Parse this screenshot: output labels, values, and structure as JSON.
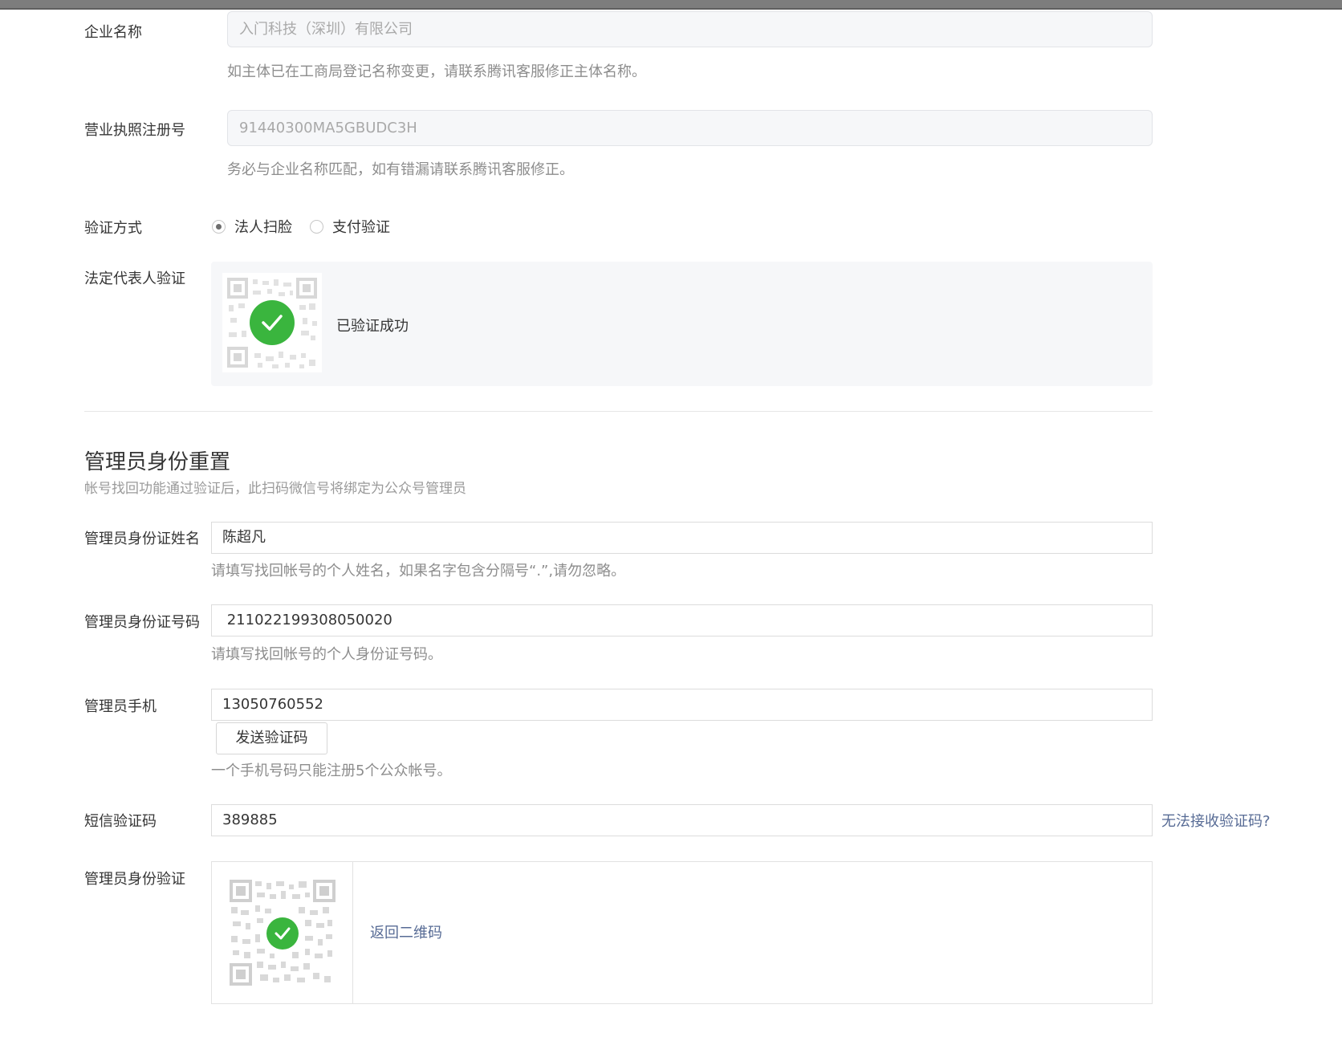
{
  "company": {
    "name_label": "企业名称",
    "name_value": "入门科技（深圳）有限公司",
    "name_hint": "如主体已在工商局登记名称变更，请联系腾讯客服修正主体名称。",
    "license_label": "营业执照注册号",
    "license_value": "91440300MA5GBUDC3H",
    "license_hint": "务必与企业名称匹配，如有错漏请联系腾讯客服修正。"
  },
  "verify_method": {
    "label": "验证方式",
    "options": [
      "法人扫脸",
      "支付验证"
    ],
    "selected": "法人扫脸"
  },
  "legal_verify": {
    "label": "法定代表人验证",
    "status": "已验证成功",
    "icon": "qr-code-icon",
    "status_icon": "check-circle-icon",
    "success_color": "#3ab53e"
  },
  "admin_reset": {
    "title": "管理员身份重置",
    "desc": "帐号找回功能通过验证后，此扫码微信号将绑定为公众号管理员",
    "name_label": "管理员身份证姓名",
    "name_value": "陈超凡",
    "name_hint": "请填写找回帐号的个人姓名，如果名字包含分隔号“.”,请勿忽略。",
    "id_label": "管理员身份证号码",
    "id_value": " 211022199308050020",
    "id_hint": "请填写找回帐号的个人身份证号码。",
    "phone_label": "管理员手机",
    "phone_value": "13050760552",
    "send_code_button": "发送验证码",
    "phone_hint": "一个手机号码只能注册5个公众帐号。",
    "sms_label": "短信验证码",
    "sms_value": "389885",
    "sms_help_link": "无法接收验证码?",
    "identity_label": "管理员身份验证",
    "return_qr_link": "返回二维码",
    "link_color": "#576b95"
  }
}
